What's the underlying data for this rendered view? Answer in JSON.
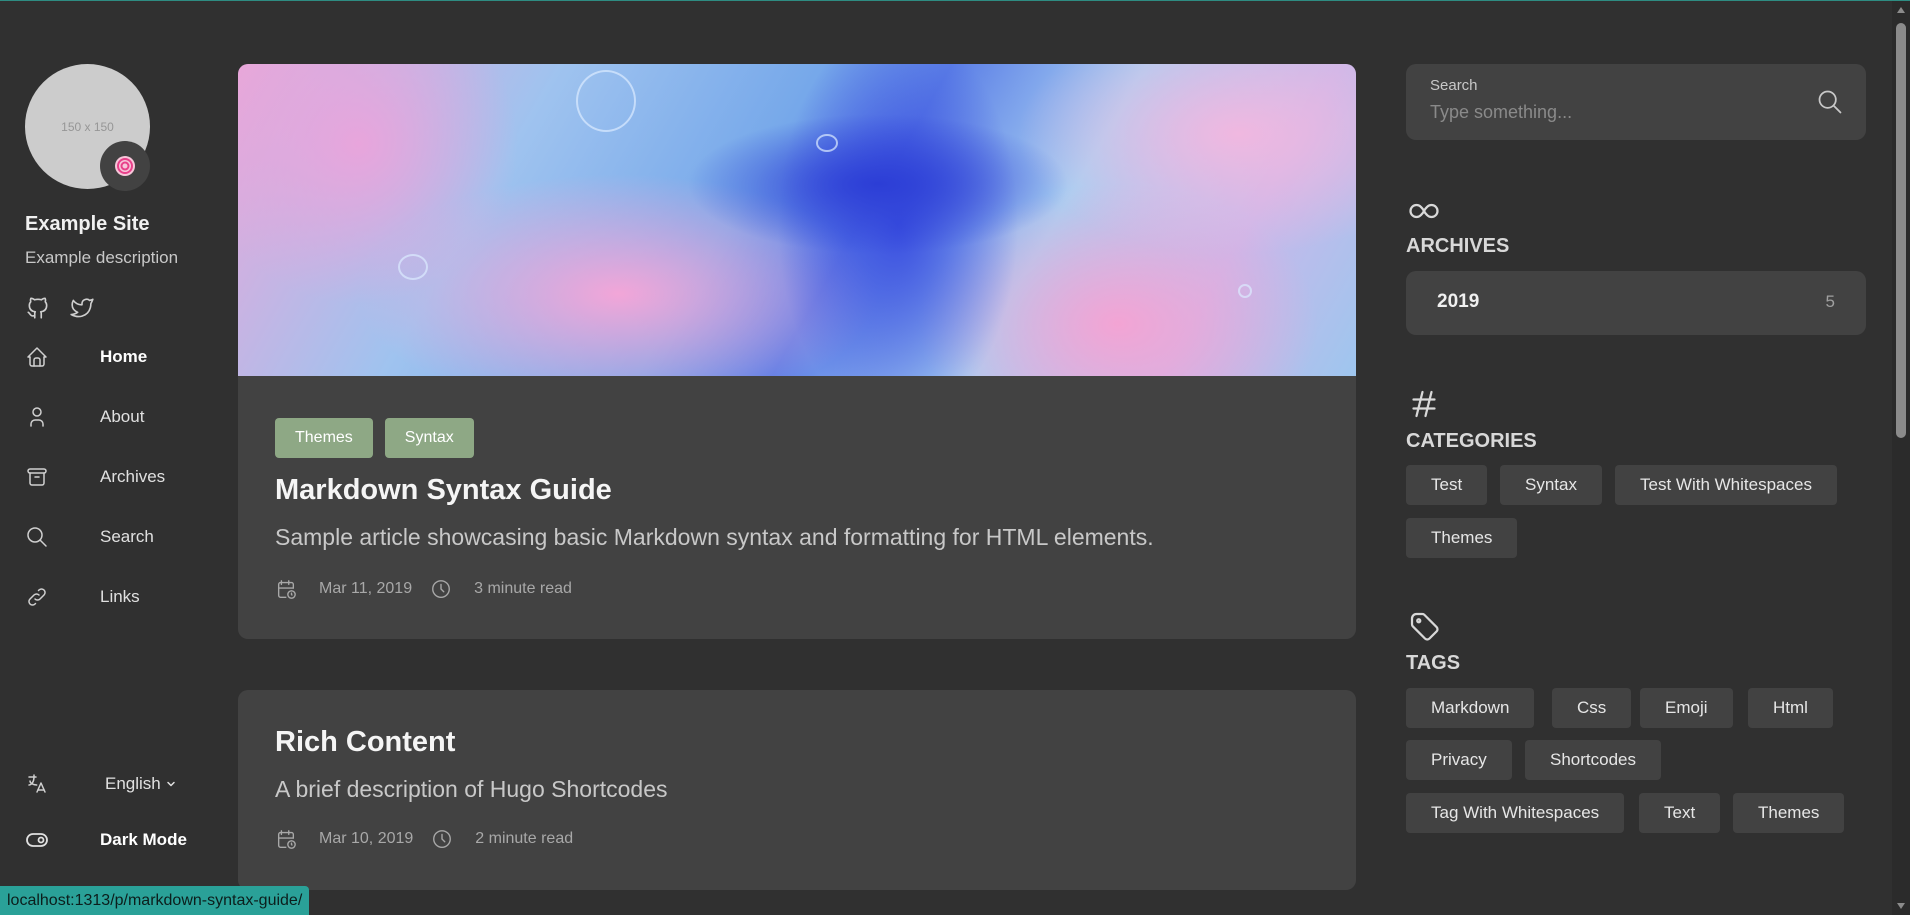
{
  "site": {
    "avatar_placeholder": "150 x 150",
    "avatar_emoji": "lollipop-icon",
    "name": "Example Site",
    "description": "Example description",
    "social": [
      "github-icon",
      "twitter-icon"
    ]
  },
  "menu": {
    "items": [
      {
        "label": "Home",
        "icon": "home-icon",
        "active": true
      },
      {
        "label": "About",
        "icon": "user-icon"
      },
      {
        "label": "Archives",
        "icon": "archive-icon"
      },
      {
        "label": "Search",
        "icon": "search-icon"
      },
      {
        "label": "Links",
        "icon": "link-icon"
      }
    ],
    "language": "English",
    "dark_mode": "Dark Mode"
  },
  "articles": [
    {
      "categories": [
        "Themes",
        "Syntax"
      ],
      "title": "Markdown Syntax Guide",
      "subtitle": "Sample article showcasing basic Markdown syntax and formatting for HTML elements.",
      "date": "Mar 11, 2019",
      "reading_time": "3 minute read"
    },
    {
      "title": "Rich Content",
      "subtitle": "A brief description of Hugo Shortcodes",
      "date": "Mar 10, 2019",
      "reading_time": "2 minute read"
    }
  ],
  "search": {
    "label": "Search",
    "placeholder": "Type something..."
  },
  "archives": {
    "title": "ARCHIVES",
    "year": "2019",
    "count": "5"
  },
  "categories": {
    "title": "CATEGORIES",
    "items": [
      "Test",
      "Syntax",
      "Test With Whitespaces",
      "Themes"
    ]
  },
  "tags": {
    "title": "TAGS",
    "items": [
      "Markdown",
      "Css",
      "Emoji",
      "Html",
      "Privacy",
      "Shortcodes",
      "Tag With Whitespaces",
      "Text",
      "Themes"
    ]
  },
  "status_url": "localhost:1313/p/markdown-syntax-guide/",
  "colors": {
    "background": "#303030",
    "card": "#424242",
    "accent_tag": "#8ea885",
    "status": "#2aa198"
  }
}
